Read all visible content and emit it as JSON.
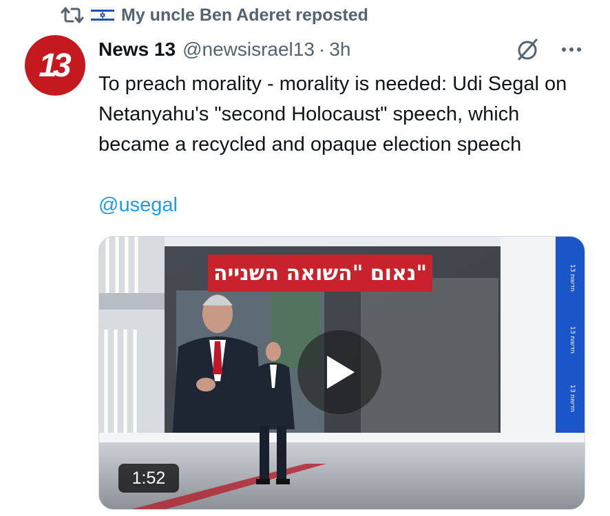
{
  "repost": {
    "flag_icon": "israel-flag-icon",
    "label": "My uncle Ben Aderet reposted"
  },
  "author": {
    "avatar_text": "13",
    "name": "News 13",
    "handle": "@newsisrael13",
    "separator": "·",
    "time": "3h"
  },
  "tweet": {
    "text": "To preach morality - morality is needed: Udi Segal on Netanyahu's \"second Holocaust\" speech, which became a recycled and opaque election speech",
    "mention": "@usegal"
  },
  "media": {
    "banner_text": "נאום \"השואה השנייה\"",
    "duration": "1:52",
    "side_label": "חדשות 13"
  },
  "colors": {
    "brand_red": "#c3191f",
    "link_blue": "#1d9bf0",
    "muted": "#536471"
  }
}
